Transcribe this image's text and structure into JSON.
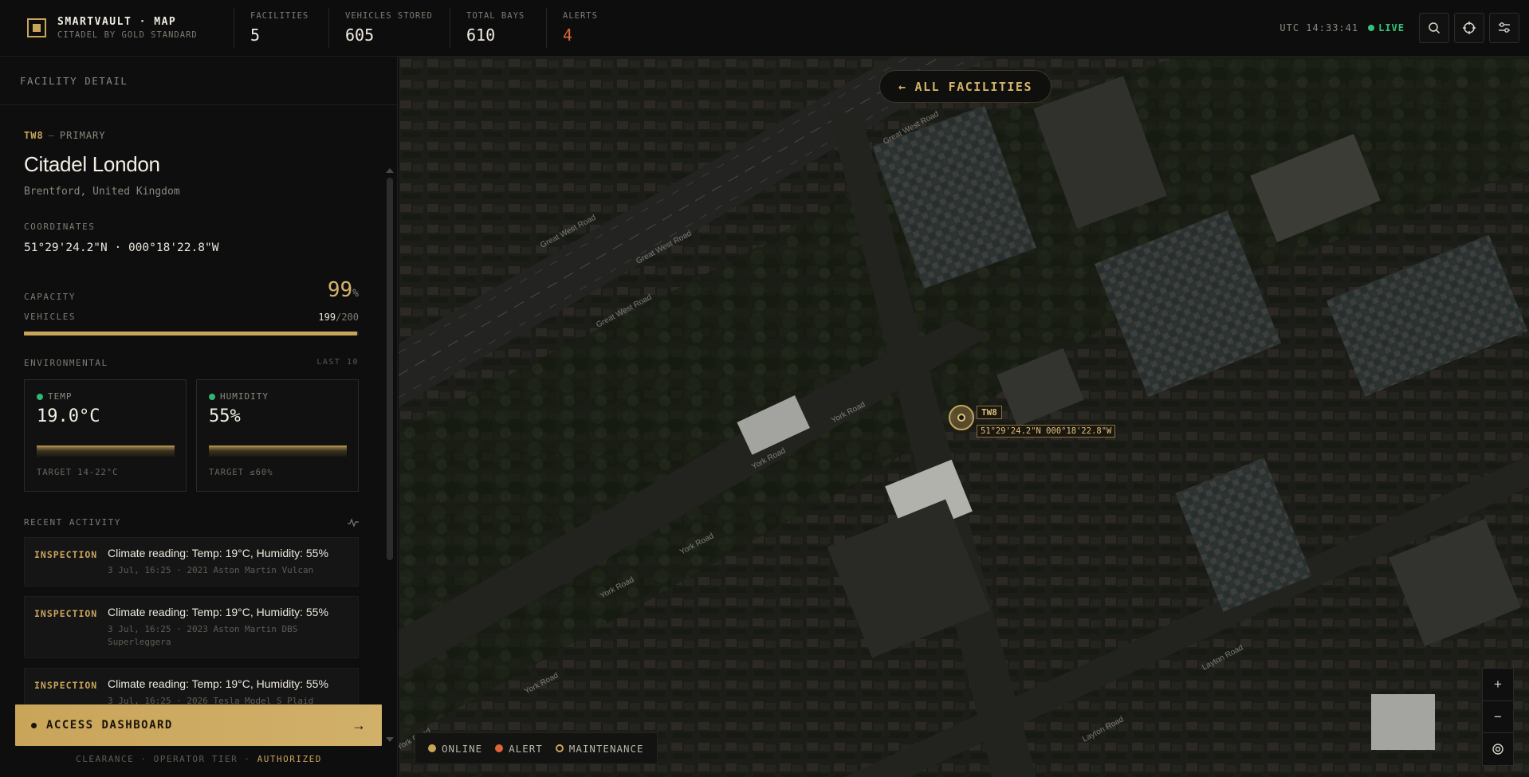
{
  "brand": {
    "name": "SMARTVAULT · MAP",
    "subtitle": "CITADEL BY GOLD STANDARD"
  },
  "stats": [
    {
      "label": "FACILITIES",
      "value": "5"
    },
    {
      "label": "VEHICLES STORED",
      "value": "605"
    },
    {
      "label": "TOTAL BAYS",
      "value": "610"
    },
    {
      "label": "ALERTS",
      "value": "4"
    }
  ],
  "topbar": {
    "utc": "UTC 14:33:41",
    "live": "LIVE"
  },
  "icons": {
    "search": "search-icon",
    "locate": "crosshair-icon",
    "settings": "sliders-icon",
    "back": "arrow-left-icon",
    "cta": "arrow-right-icon",
    "activity": "pulse-icon"
  },
  "sidebar": {
    "title": "FACILITY DETAIL",
    "code": "TW8",
    "sep": "—",
    "tier": "PRIMARY",
    "name": "Citadel London",
    "location": "Brentford, United Kingdom",
    "coords_label": "COORDINATES",
    "coords": "51°29'24.2\"N · 000°18'22.8\"W",
    "capacity_label": "CAPACITY",
    "capacity_value": "99",
    "capacity_unit": "%",
    "vehicles_label": "VEHICLES",
    "vehicles_count": "199",
    "vehicles_total": "/200",
    "vehicles_fraction": 0.995,
    "env_label": "ENVIRONMENTAL",
    "env_window": "LAST 10",
    "temp": {
      "label": "TEMP",
      "value": "19.0°C",
      "target": "TARGET 14-22°C"
    },
    "humidity": {
      "label": "HUMIDITY",
      "value": "55%",
      "target": "TARGET ≤60%"
    },
    "activity_label": "RECENT ACTIVITY",
    "activity": [
      {
        "type": "INSPECTION",
        "title": "Climate reading: Temp: 19°C, Humidity: 55%",
        "meta": "3 Jul, 16:25 · 2021 Aston Martin Vulcan"
      },
      {
        "type": "INSPECTION",
        "title": "Climate reading: Temp: 19°C, Humidity: 55%",
        "meta": "3 Jul, 16:25 · 2023 Aston Martin DBS Superleggera"
      },
      {
        "type": "INSPECTION",
        "title": "Climate reading: Temp: 19°C, Humidity: 55%",
        "meta": "3 Jul, 16:25 · 2026 Tesla Model S Plaid"
      }
    ],
    "cta": "ACCESS DASHBOARD",
    "clearance": "CLEARANCE · OPERATOR TIER ·",
    "clearance_status": "AUTHORIZED"
  },
  "map": {
    "back_label": "ALL FACILITIES",
    "marker_code": "TW8",
    "marker_coords": "51°29'24.2\"N 000°18'22.8\"W",
    "roads": [
      "Great West Road",
      "Great West Road",
      "Great West Road",
      "Great West Road",
      "York Road",
      "York Road",
      "York Road",
      "York Road",
      "York Road",
      "York Road",
      "Layton Road",
      "Layton Road"
    ],
    "legend": [
      {
        "label": "ONLINE",
        "color": "#c9a55a"
      },
      {
        "label": "ALERT",
        "color": "#e0643a"
      },
      {
        "label": "MAINTENANCE",
        "color": "#c9a55a"
      }
    ],
    "zoom_in": "+",
    "zoom_out": "−",
    "recenter": "target-icon"
  },
  "colors": {
    "accent": "#c9a55a",
    "alert": "#e0643a",
    "live": "#33c47a"
  }
}
